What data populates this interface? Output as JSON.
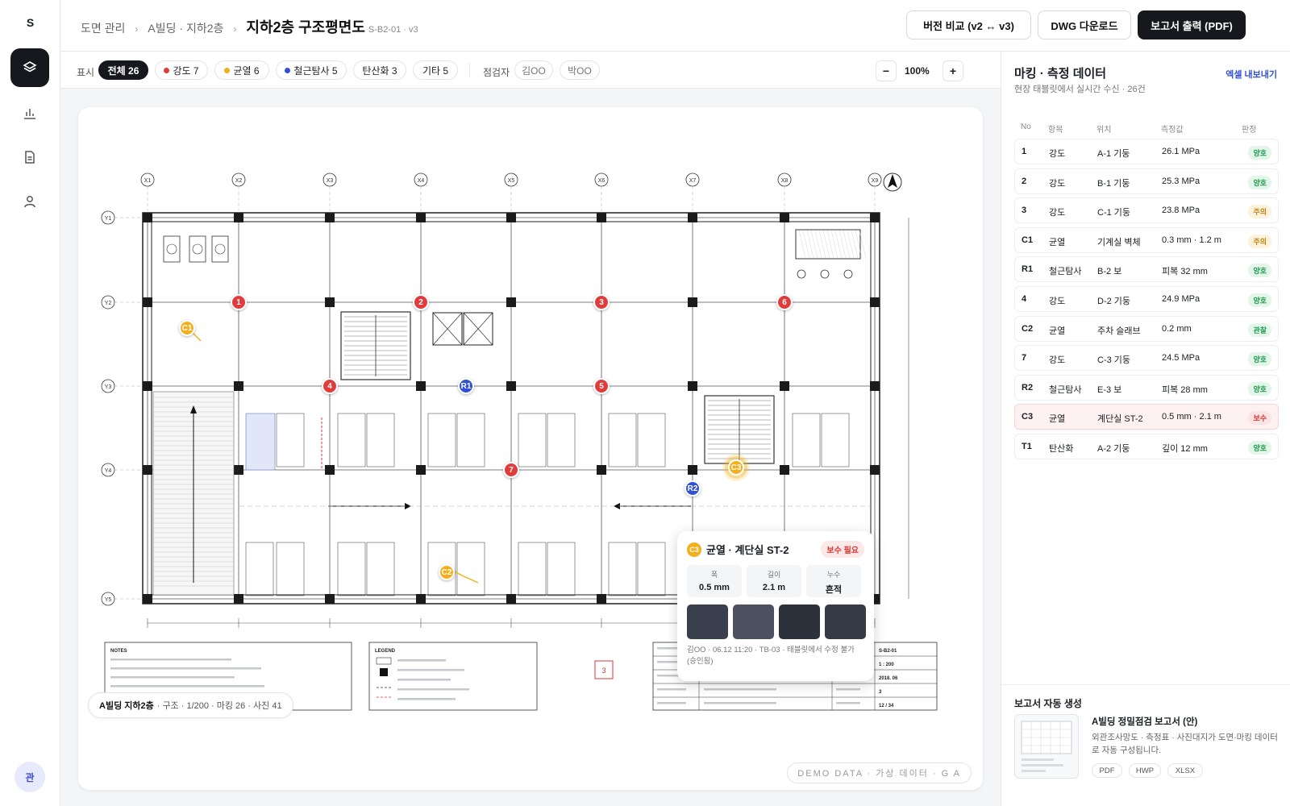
{
  "app": {
    "logo": "S",
    "avatar": "관"
  },
  "header": {
    "breadcrumb": [
      "도면 관리",
      "A빌딩 · 지하2층"
    ],
    "title": "지하2층 구조평면도",
    "subtitle": "S-B2-01 · v3",
    "compare_label": "버전 비교 (v2 ↔ v3)",
    "dwg_label": "DWG 다운로드",
    "report_label": "보고서 출력 (PDF)"
  },
  "filters": {
    "label": "표시",
    "chips": [
      {
        "label": "전체 26",
        "color": ""
      },
      {
        "label": "강도 7",
        "color": "#e23b3b"
      },
      {
        "label": "균열 6",
        "color": "#f2b01e"
      },
      {
        "label": "철근탐사 5",
        "color": "#3150d6"
      },
      {
        "label": "탄산화 3",
        "color": ""
      },
      {
        "label": "기타 5",
        "color": ""
      }
    ],
    "inspector_label": "점검자",
    "inspectors": [
      "김OO",
      "박OO"
    ],
    "zoom": "100%",
    "zoom_out": "−",
    "zoom_in": "+"
  },
  "drawing": {
    "grid_cols": [
      "X1",
      "X2",
      "X3",
      "X4",
      "X5",
      "X6",
      "X7",
      "X8",
      "X9"
    ],
    "grid_rows": [
      "Y1",
      "Y2",
      "Y3",
      "Y4",
      "Y5"
    ],
    "notes_title": "NOTES",
    "legend_title": "LEGEND",
    "rev_mark": "3",
    "sheet_no": "S-B2-01",
    "scale": "1 : 200",
    "date": "2018. 06",
    "rev": "3",
    "sheet": "12 / 34",
    "markers": [
      {
        "id": "1",
        "kind": "red"
      },
      {
        "id": "2",
        "kind": "red"
      },
      {
        "id": "3",
        "kind": "red"
      },
      {
        "id": "6",
        "kind": "red"
      },
      {
        "id": "4",
        "kind": "red"
      },
      {
        "id": "5",
        "kind": "red"
      },
      {
        "id": "7",
        "kind": "red"
      },
      {
        "id": "R1",
        "kind": "blue"
      },
      {
        "id": "R2",
        "kind": "blue"
      },
      {
        "id": "C1",
        "kind": "amber"
      },
      {
        "id": "C2",
        "kind": "amber"
      },
      {
        "id": "C3",
        "kind": "amber"
      }
    ]
  },
  "popup": {
    "code": "C3",
    "title": "균열 · 계단실 ST-2",
    "badge": "보수 필요",
    "stats": [
      {
        "k": "폭",
        "v": "0.5 mm"
      },
      {
        "k": "길이",
        "v": "2.1 m"
      },
      {
        "k": "누수",
        "v": "흔적"
      }
    ],
    "footer": "김OO · 06.12 11:20 · TB-03 · 태블릿에서 수정 불가 (승인됨)"
  },
  "canvas_info": {
    "bold": "A빌딩 지하2층",
    "rest": "· 구조 · 1/200 · 마킹 26 · 사진 41"
  },
  "watermark": "DEMO DATA · 가상 데이터 · G A",
  "panel": {
    "title": "마킹 · 측정 데이터",
    "subtitle": "현장 태블릿에서 실시간 수신 · 26건",
    "export": "엑셀 내보내기",
    "columns": [
      "No",
      "항목",
      "위치",
      "측정값",
      "판정"
    ],
    "rows": [
      {
        "no": "1",
        "item": "강도",
        "loc": "A-1 기둥",
        "val": "26.1 MPa",
        "judge": "양호",
        "cls": "b-good"
      },
      {
        "no": "2",
        "item": "강도",
        "loc": "B-1 기둥",
        "val": "25.3 MPa",
        "judge": "양호",
        "cls": "b-good"
      },
      {
        "no": "3",
        "item": "강도",
        "loc": "C-1 기둥",
        "val": "23.8 MPa",
        "judge": "주의",
        "cls": "b-warn"
      },
      {
        "no": "C1",
        "item": "균열",
        "loc": "기계실 벽체",
        "val": "0.3 mm · 1.2 m",
        "judge": "주의",
        "cls": "b-warn"
      },
      {
        "no": "R1",
        "item": "철근탐사",
        "loc": "B-2 보",
        "val": "피복 32 mm",
        "judge": "양호",
        "cls": "b-good"
      },
      {
        "no": "4",
        "item": "강도",
        "loc": "D-2 기둥",
        "val": "24.9 MPa",
        "judge": "양호",
        "cls": "b-good"
      },
      {
        "no": "C2",
        "item": "균열",
        "loc": "주차 슬래브",
        "val": "0.2 mm",
        "judge": "관찰",
        "cls": "b-obs"
      },
      {
        "no": "7",
        "item": "강도",
        "loc": "C-3 기둥",
        "val": "24.5 MPa",
        "judge": "양호",
        "cls": "b-good"
      },
      {
        "no": "R2",
        "item": "철근탐사",
        "loc": "E-3 보",
        "val": "피복 28 mm",
        "judge": "양호",
        "cls": "b-good"
      },
      {
        "no": "C3",
        "item": "균열",
        "loc": "계단실 ST-2",
        "val": "0.5 mm · 2.1 m",
        "judge": "보수",
        "cls": "b-bad"
      },
      {
        "no": "T1",
        "item": "탄산화",
        "loc": "A-2 기둥",
        "val": "깊이 12 mm",
        "judge": "양호",
        "cls": "b-good"
      }
    ],
    "report_header": "보고서 자동 생성",
    "report_title": "A빌딩 정밀점검 보고서 (안)",
    "report_desc": "외관조사망도 · 측정표 · 사진대지가 도면·마킹 데이터로 자동 구성됩니다.",
    "formats": [
      "PDF",
      "HWP",
      "XLSX"
    ]
  }
}
